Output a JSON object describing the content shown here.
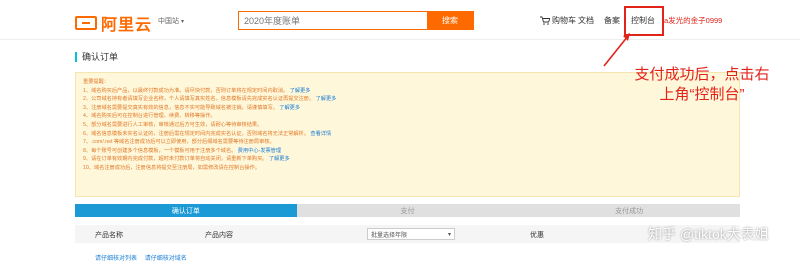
{
  "header": {
    "logo_text": "阿里云",
    "region": "中国站",
    "search_placeholder": "2020年度账单",
    "search_button": "搜索",
    "cart": "购物车",
    "docs": "文档",
    "record": "备案",
    "console": "控制台",
    "user": "a发光的金子0999"
  },
  "page": {
    "title": "确认订单"
  },
  "notice": {
    "lines": [
      {
        "text": "重要提醒："
      },
      {
        "text": "1、域名购买后产品，以最终付款成功为准。请尽快付款，否则订单将在规定时间内取消。",
        "link": "了解更多"
      },
      {
        "text": "2、公司域名持有者请填写企业名称，个人请填写真实姓名。信息模板请先完成实名认证再提交注册。",
        "link": "了解更多"
      },
      {
        "text": "3、注册域名需要提交真实有效的信息，信息不实可能导致域名被注销，请谨慎填写。",
        "link": "了解更多"
      },
      {
        "text": "4、域名购买后可在控制台进行管理、续费、转移等操作。"
      },
      {
        "text": "5、部分域名需要进行人工审核，审核通过后方可生效，请耐心等待审核结果。"
      },
      {
        "text": "6、域名信息模板未实名认证的，注册后需在规定时间内完成实名认证，否则域名将无法正常解析。",
        "link": "查看详情"
      },
      {
        "text": "7、.com/.net 等域名注册成功后可以立即使用，部分后缀域名需要等待注册局审核。"
      },
      {
        "text": "8、每个账号可创建多个信息模板，一个模板可用于注册多个域名。",
        "link": "费用中心-发票管理"
      },
      {
        "text": "9、请在订单有效期内完成付款，超时未付款订单将自动关闭，请重新下单购买。",
        "link": "了解更多"
      },
      {
        "text": "10、域名注册成功后，注册信息将提交至注册局，如需修改请在控制台操作。"
      }
    ]
  },
  "annotation": {
    "line1": "支付成功后，点击右",
    "line2": "上角“控制台”"
  },
  "steps": [
    {
      "label": "确认订单",
      "state": "active"
    },
    {
      "label": "支付",
      "state": "inactive"
    },
    {
      "label": "支付成功",
      "state": "inactive"
    }
  ],
  "table": {
    "col_product": "产品名称",
    "col_content": "产品内容",
    "select_value": "批量选择年限",
    "col_discount": "优惠"
  },
  "footer_links": {
    "link1": "请仔细核对列表",
    "link2": "请仔细核对域名"
  },
  "watermark": "知乎 @tiktok大表姐",
  "colors": {
    "brand": "#ff6a00",
    "annotation": "#e2231a",
    "step_active": "#1b9ad6",
    "link": "#1a7ed6"
  }
}
